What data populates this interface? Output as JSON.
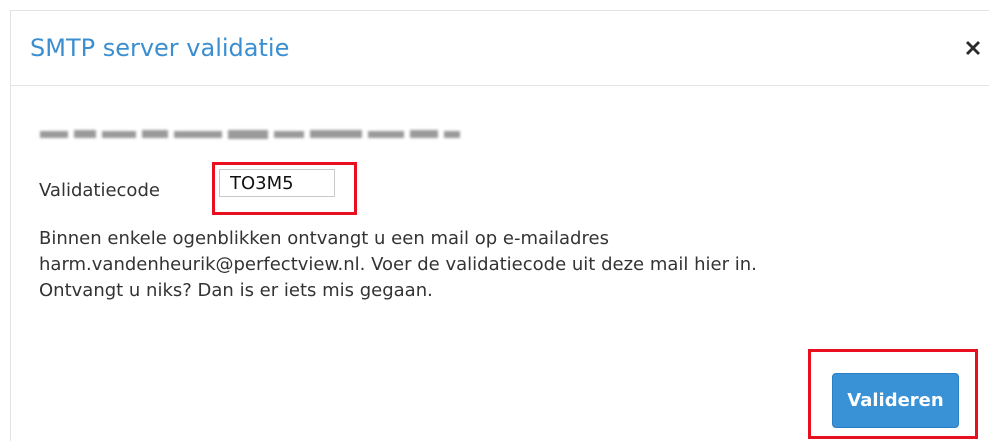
{
  "dialog": {
    "title": "SMTP server validatie",
    "close_icon": "close-x-icon"
  },
  "form": {
    "code_label": "Validatiecode",
    "code_value": "TO3M5"
  },
  "message": {
    "line1": "Binnen enkele ogenblikken ontvangt u een mail op e-mailadres",
    "line2": "harm.vandenheurik@perfectview.nl. Voer de validatiecode uit deze mail hier in.",
    "line3": "Ontvangt u niks? Dan is er iets mis gegaan."
  },
  "actions": {
    "validate_label": "Valideren"
  },
  "colors": {
    "title": "#3b8fd0",
    "button": "#3a92d6",
    "highlight": "#e8101e"
  }
}
